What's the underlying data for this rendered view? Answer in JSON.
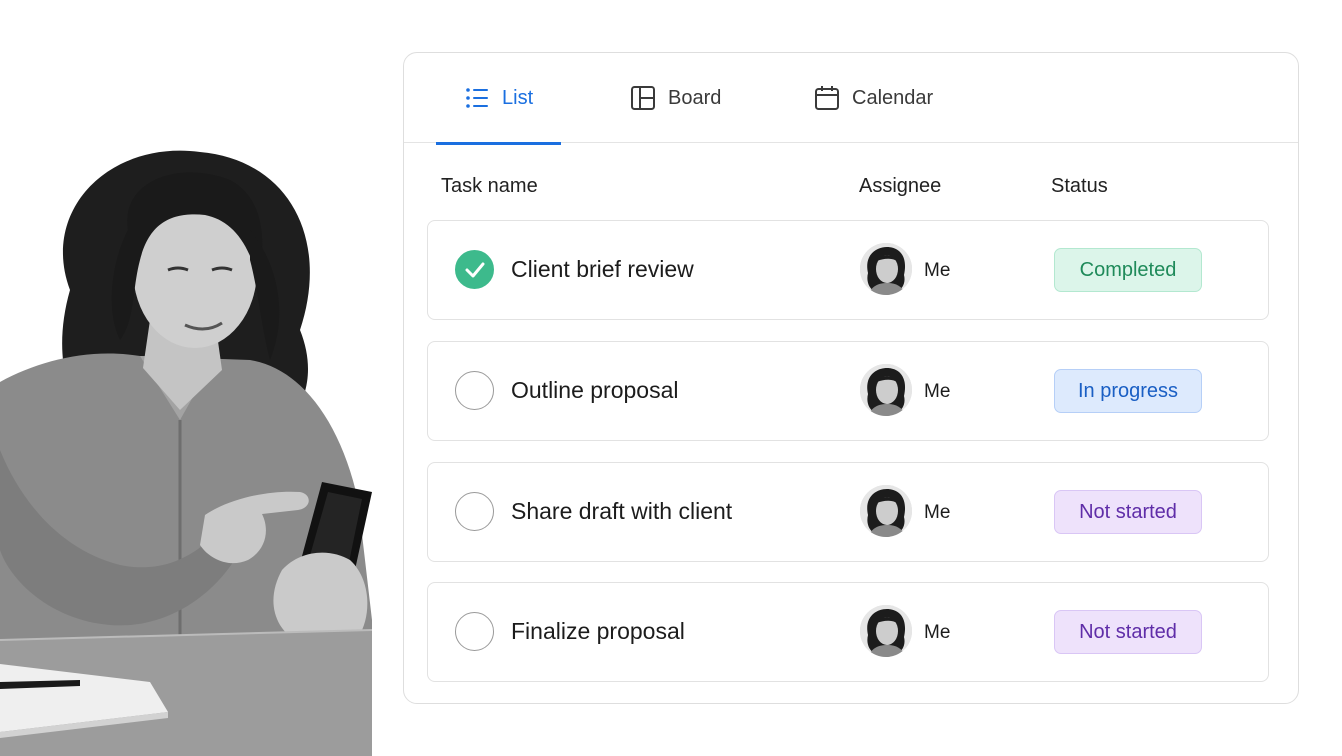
{
  "tabs": [
    {
      "label": "List",
      "icon": "list-icon",
      "active": true
    },
    {
      "label": "Board",
      "icon": "board-icon",
      "active": false
    },
    {
      "label": "Calendar",
      "icon": "calendar-icon",
      "active": false
    }
  ],
  "columns": {
    "task": "Task name",
    "assignee": "Assignee",
    "status": "Status"
  },
  "tasks": [
    {
      "name": "Client brief review",
      "done": true,
      "assignee": "Me",
      "status": "Completed"
    },
    {
      "name": "Outline proposal",
      "done": false,
      "assignee": "Me",
      "status": "In progress"
    },
    {
      "name": "Share draft with client",
      "done": false,
      "assignee": "Me",
      "status": "Not started"
    },
    {
      "name": "Finalize proposal",
      "done": false,
      "assignee": "Me",
      "status": "Not started"
    }
  ],
  "colors": {
    "accent": "#1a6fe0",
    "completed": "#3dba8c",
    "completed_badge_bg": "#dcf5ea",
    "in_progress_badge_bg": "#ddeafd",
    "not_started_badge_bg": "#eee2fb"
  }
}
